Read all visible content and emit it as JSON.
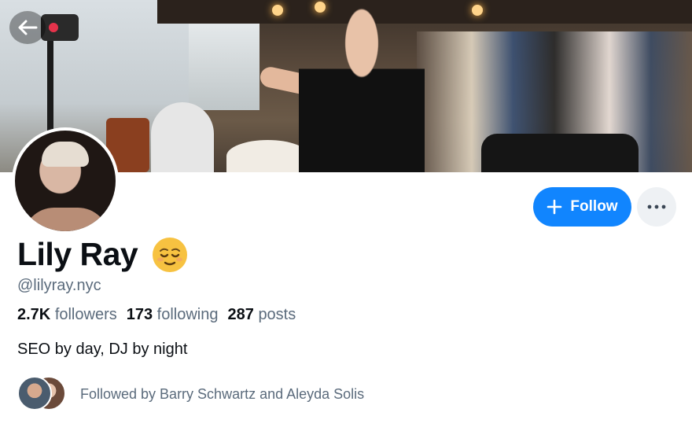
{
  "banner": {
    "alt": "Profile banner",
    "recording_icon": "record-icon"
  },
  "nav": {
    "back_icon": "arrow-left-icon"
  },
  "profile": {
    "display_name": "Lily Ray",
    "emoji": "relieved-face-emoji",
    "handle": "@lilyray.nyc",
    "bio": "SEO by day, DJ by night"
  },
  "stats": {
    "followers_count": "2.7K",
    "followers_label": "followers",
    "following_count": "173",
    "following_label": "following",
    "posts_count": "287",
    "posts_label": "posts"
  },
  "actions": {
    "follow_label": "Follow",
    "follow_icon": "plus-icon",
    "more_icon": "ellipsis-icon"
  },
  "followed_by": {
    "text": "Followed by Barry Schwartz and Aleyda Solis"
  },
  "colors": {
    "accent": "#1185fe",
    "muted_text": "#5b6b7c",
    "primary_text": "#0b0f14",
    "more_button_bg": "#eef1f4"
  }
}
